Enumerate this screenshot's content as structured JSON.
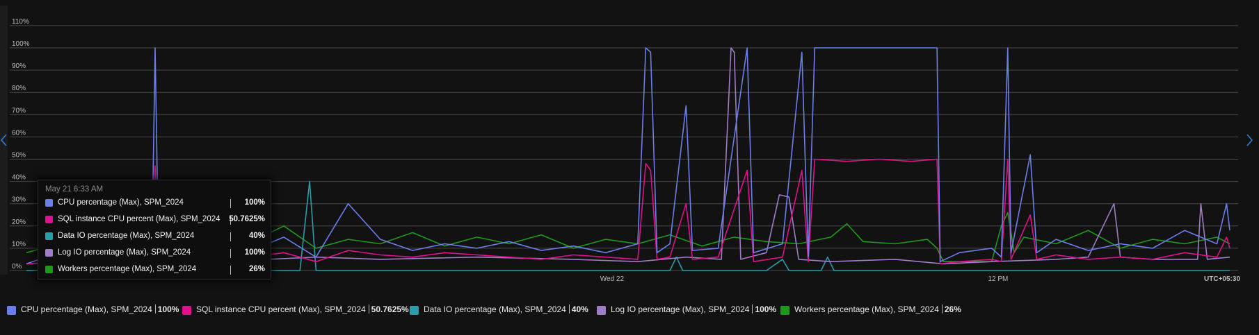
{
  "chart_data": {
    "type": "line",
    "y_ticks": [
      "0%",
      "10%",
      "20%",
      "30%",
      "40%",
      "50%",
      "60%",
      "70%",
      "80%",
      "90%",
      "100%",
      "110%"
    ],
    "ylim": [
      0,
      115
    ],
    "x_ticks": [
      {
        "label": "Wed 22",
        "t": 18.2
      },
      {
        "label": "12 PM",
        "t": 30.2
      }
    ],
    "xlim": [
      0,
      37.4
    ],
    "timezone_label": "UTC+05:30",
    "grid": true,
    "legend_position": "bottom",
    "series": [
      {
        "name": "CPU percentage (Max), SPM_2024",
        "color": "#6b7fea",
        "summary": "100%",
        "points": [
          [
            0,
            3
          ],
          [
            1,
            8
          ],
          [
            2,
            6
          ],
          [
            3,
            9
          ],
          [
            3.9,
            8
          ],
          [
            4.0,
            100
          ],
          [
            4.1,
            10
          ],
          [
            5,
            6
          ],
          [
            6,
            12
          ],
          [
            7,
            9
          ],
          [
            8,
            15
          ],
          [
            9,
            6
          ],
          [
            10,
            30
          ],
          [
            11,
            14
          ],
          [
            12,
            9
          ],
          [
            13,
            12
          ],
          [
            14,
            10
          ],
          [
            15,
            13
          ],
          [
            16,
            9
          ],
          [
            17,
            11
          ],
          [
            18,
            8
          ],
          [
            19,
            12
          ],
          [
            19.25,
            100
          ],
          [
            19.4,
            98
          ],
          [
            19.6,
            8
          ],
          [
            20,
            12
          ],
          [
            20.5,
            74
          ],
          [
            20.7,
            9
          ],
          [
            21.5,
            10
          ],
          [
            22.4,
            100
          ],
          [
            22.6,
            8
          ],
          [
            23.5,
            12
          ],
          [
            24.1,
            98
          ],
          [
            24.3,
            6
          ],
          [
            24.5,
            100
          ],
          [
            24.6,
            100
          ],
          [
            28.3,
            100
          ],
          [
            28.4,
            4
          ],
          [
            29,
            8
          ],
          [
            30,
            10
          ],
          [
            30.3,
            6
          ],
          [
            30.5,
            100
          ],
          [
            30.6,
            8
          ],
          [
            31.2,
            52
          ],
          [
            31.4,
            8
          ],
          [
            32,
            14
          ],
          [
            33,
            9
          ],
          [
            34,
            12
          ],
          [
            35,
            10
          ],
          [
            36,
            18
          ],
          [
            37,
            12
          ],
          [
            37.3,
            30
          ],
          [
            37.4,
            18
          ]
        ]
      },
      {
        "name": "SQL instance CPU percent (Max), SPM_2024",
        "color": "#e0108c",
        "summary": "50.7625%",
        "points": [
          [
            0,
            3
          ],
          [
            1,
            4
          ],
          [
            2,
            5
          ],
          [
            3,
            6
          ],
          [
            3.9,
            5
          ],
          [
            4.0,
            47
          ],
          [
            4.1,
            6
          ],
          [
            5,
            5
          ],
          [
            6,
            7
          ],
          [
            7,
            6
          ],
          [
            8,
            8
          ],
          [
            9,
            4
          ],
          [
            10,
            9
          ],
          [
            11,
            7
          ],
          [
            12,
            6
          ],
          [
            13,
            8
          ],
          [
            14,
            7
          ],
          [
            15,
            6
          ],
          [
            16,
            5
          ],
          [
            17,
            7
          ],
          [
            18,
            6
          ],
          [
            19,
            5
          ],
          [
            19.25,
            48
          ],
          [
            19.4,
            45
          ],
          [
            19.6,
            5
          ],
          [
            20,
            6
          ],
          [
            20.5,
            30
          ],
          [
            20.7,
            5
          ],
          [
            21.5,
            6
          ],
          [
            22.4,
            45
          ],
          [
            22.6,
            4
          ],
          [
            23.5,
            6
          ],
          [
            24.1,
            45
          ],
          [
            24.3,
            4
          ],
          [
            24.5,
            50
          ],
          [
            25.5,
            49
          ],
          [
            26.5,
            50
          ],
          [
            27.5,
            49
          ],
          [
            28.3,
            50
          ],
          [
            28.4,
            3
          ],
          [
            29,
            4
          ],
          [
            30,
            5
          ],
          [
            30.3,
            4
          ],
          [
            30.5,
            50
          ],
          [
            30.6,
            5
          ],
          [
            31.2,
            25
          ],
          [
            31.4,
            5
          ],
          [
            32,
            7
          ],
          [
            33,
            5
          ],
          [
            34,
            6
          ],
          [
            35,
            5
          ],
          [
            36,
            8
          ],
          [
            37,
            6
          ],
          [
            37.3,
            15
          ],
          [
            37.4,
            10
          ]
        ]
      },
      {
        "name": "Data IO percentage (Max), SPM_2024",
        "color": "#2a9ea8",
        "summary": "40%",
        "points": [
          [
            0,
            0
          ],
          [
            3,
            0
          ],
          [
            3.5,
            7
          ],
          [
            3.6,
            0
          ],
          [
            8.5,
            0
          ],
          [
            8.8,
            40
          ],
          [
            9.0,
            0
          ],
          [
            10,
            0
          ],
          [
            12,
            0
          ],
          [
            14,
            0
          ],
          [
            16,
            0
          ],
          [
            18,
            0
          ],
          [
            20,
            0
          ],
          [
            20.2,
            6
          ],
          [
            20.4,
            0
          ],
          [
            22,
            0
          ],
          [
            23,
            0
          ],
          [
            23.5,
            5
          ],
          [
            23.7,
            0
          ],
          [
            24.7,
            0
          ],
          [
            24.9,
            6
          ],
          [
            25.1,
            0
          ],
          [
            26,
            0
          ],
          [
            28,
            0
          ],
          [
            30,
            0
          ],
          [
            32,
            0
          ],
          [
            34,
            0
          ],
          [
            36,
            0
          ],
          [
            37.4,
            0
          ]
        ]
      },
      {
        "name": "Log IO percentage (Max), SPM_2024",
        "color": "#a07dc8",
        "summary": "100%",
        "points": [
          [
            0,
            3
          ],
          [
            3,
            5
          ],
          [
            6,
            4
          ],
          [
            9,
            6
          ],
          [
            11,
            5
          ],
          [
            14,
            6
          ],
          [
            17,
            5
          ],
          [
            19,
            4
          ],
          [
            20.5,
            6
          ],
          [
            21.6,
            5
          ],
          [
            21.9,
            100
          ],
          [
            22.0,
            98
          ],
          [
            22.2,
            5
          ],
          [
            23,
            8
          ],
          [
            23.4,
            34
          ],
          [
            23.7,
            33
          ],
          [
            24.0,
            5
          ],
          [
            25,
            4
          ],
          [
            27,
            5
          ],
          [
            28.5,
            3
          ],
          [
            30,
            4
          ],
          [
            32,
            5
          ],
          [
            33,
            6
          ],
          [
            33.8,
            30
          ],
          [
            34,
            6
          ],
          [
            35,
            5
          ],
          [
            36.4,
            5
          ],
          [
            36.5,
            30
          ],
          [
            36.7,
            5
          ],
          [
            37.4,
            6
          ]
        ]
      },
      {
        "name": "Workers percentage (Max), SPM_2024",
        "color": "#1e9a1a",
        "summary": "26%",
        "points": [
          [
            0,
            8
          ],
          [
            1,
            12
          ],
          [
            2,
            10
          ],
          [
            3,
            14
          ],
          [
            4,
            12
          ],
          [
            5,
            15
          ],
          [
            6,
            11
          ],
          [
            7,
            13
          ],
          [
            8,
            20
          ],
          [
            9,
            10
          ],
          [
            10,
            14
          ],
          [
            11,
            12
          ],
          [
            12,
            17
          ],
          [
            13,
            11
          ],
          [
            14,
            15
          ],
          [
            15,
            12
          ],
          [
            16,
            16
          ],
          [
            17,
            10
          ],
          [
            18,
            14
          ],
          [
            19,
            12
          ],
          [
            20,
            16
          ],
          [
            21,
            11
          ],
          [
            22,
            15
          ],
          [
            23,
            13
          ],
          [
            24,
            12
          ],
          [
            25,
            15
          ],
          [
            25.5,
            21
          ],
          [
            26,
            13
          ],
          [
            27,
            12
          ],
          [
            28,
            14
          ],
          [
            28.3,
            10
          ],
          [
            28.5,
            4
          ],
          [
            29,
            4
          ],
          [
            30,
            4
          ],
          [
            30.3,
            20
          ],
          [
            30.5,
            26
          ],
          [
            30.7,
            8
          ],
          [
            31,
            15
          ],
          [
            32,
            12
          ],
          [
            33,
            18
          ],
          [
            34,
            10
          ],
          [
            35,
            14
          ],
          [
            36,
            12
          ],
          [
            37,
            15
          ],
          [
            37.4,
            12
          ]
        ]
      }
    ]
  },
  "tooltip": {
    "time": "May 21 6:33 AM",
    "rows": [
      {
        "name": "CPU percentage (Max), SPM_2024",
        "value": "100%",
        "color": "#6b7fea"
      },
      {
        "name": "SQL instance CPU percent (Max), SPM_2024",
        "value": "50.7625%",
        "color": "#e0108c"
      },
      {
        "name": "Data IO percentage (Max), SPM_2024",
        "value": "40%",
        "color": "#2a9ea8"
      },
      {
        "name": "Log IO percentage (Max), SPM_2024",
        "value": "100%",
        "color": "#a07dc8"
      },
      {
        "name": "Workers percentage (Max), SPM_2024",
        "value": "26%",
        "color": "#1e9a1a"
      }
    ]
  },
  "legend": [
    {
      "name": "CPU percentage (Max), SPM_2024",
      "value": "100%",
      "color": "#6b7fea"
    },
    {
      "name": "SQL instance CPU percent (Max), SPM_2024",
      "value": "50.7625%",
      "color": "#e0108c"
    },
    {
      "name": "Data IO percentage (Max), SPM_2024",
      "value": "40%",
      "color": "#2a9ea8"
    },
    {
      "name": "Log IO percentage (Max), SPM_2024",
      "value": "100%",
      "color": "#a07dc8"
    },
    {
      "name": "Workers percentage (Max), SPM_2024",
      "value": "26%",
      "color": "#1e9a1a"
    }
  ],
  "nav": {
    "left_icon": "chevron-left-icon",
    "right_icon": "chevron-right-icon",
    "arrow_color": "#2f7fd6"
  }
}
